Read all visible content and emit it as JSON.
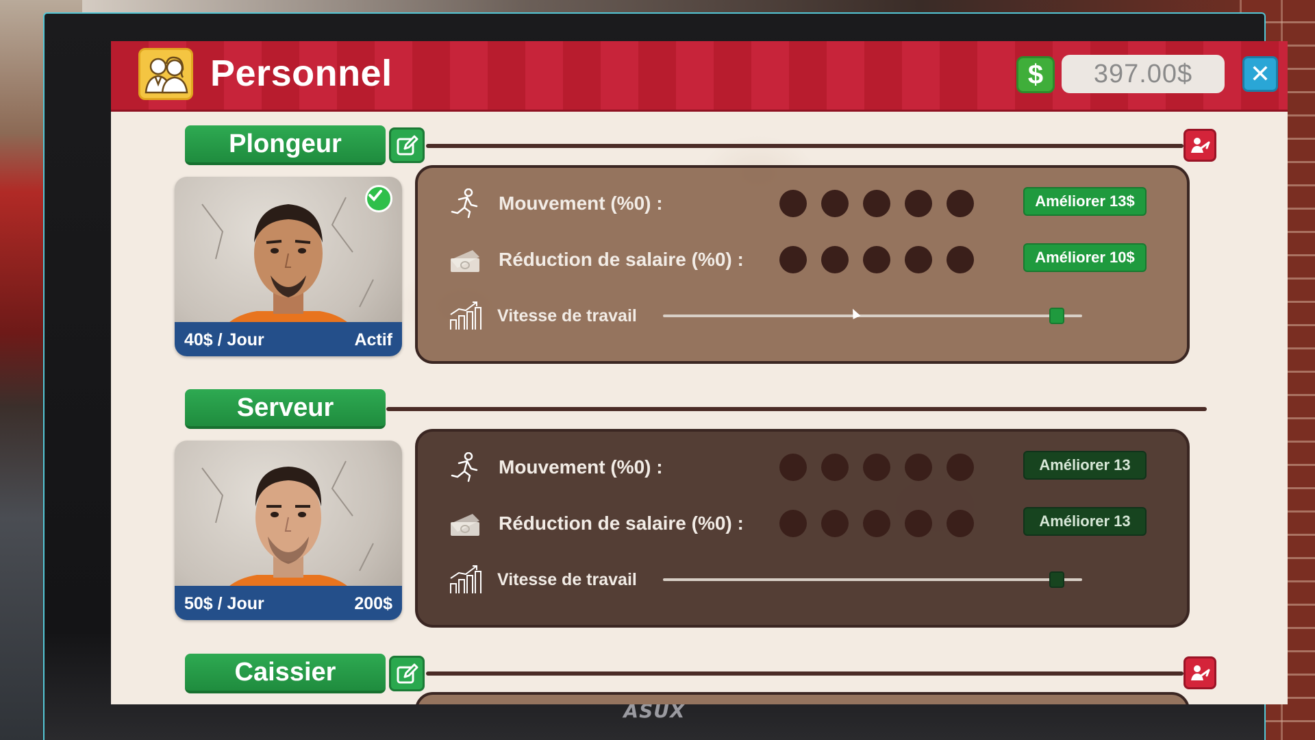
{
  "window": {
    "title": "Personnel",
    "money": "397.00$",
    "close_label": "✕",
    "dollar_symbol": "$",
    "brand": "ASUX"
  },
  "colors": {
    "header_red": "#c7243a",
    "button_green": "#1f9a3e",
    "close_blue": "#2aa6d6",
    "card_footer_blue": "#244f8a"
  },
  "staff": [
    {
      "role": "Plongeur",
      "salary": "40$ / Jour",
      "status": "Actif",
      "hired": true,
      "stats": [
        {
          "label": "Mouvement (%0) :",
          "icon": "running-icon",
          "level": 0,
          "max": 5,
          "button": "Améliorer  13$"
        },
        {
          "label": "Réduction de salaire (%0) :",
          "icon": "money-icon",
          "level": 0,
          "max": 5,
          "button": "Améliorer  10$"
        }
      ],
      "speed": {
        "label": "Vitesse de travail",
        "icon": "chart-icon",
        "value": 0.94
      }
    },
    {
      "role": "Serveur",
      "salary": "50$ / Jour",
      "status": "200$",
      "hired": false,
      "stats": [
        {
          "label": "Mouvement (%0) :",
          "icon": "running-icon",
          "level": 0,
          "max": 5,
          "button": "Améliorer  13"
        },
        {
          "label": "Réduction de salaire (%0) :",
          "icon": "money-icon",
          "level": 0,
          "max": 5,
          "button": "Améliorer  13"
        }
      ],
      "speed": {
        "label": "Vitesse de travail",
        "icon": "chart-icon",
        "value": 0.94
      }
    },
    {
      "role": "Caissier",
      "hired": true
    }
  ]
}
